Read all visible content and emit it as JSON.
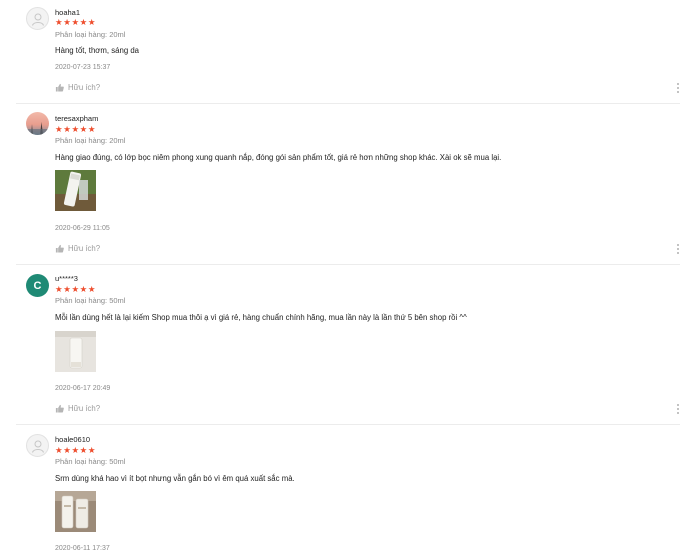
{
  "reviews": [
    {
      "username": "hoaha1",
      "stars": "★★★★★",
      "variant": "Phân loại hàng: 20ml",
      "comment": "Hàng tốt, thơm, sáng da",
      "date": "2020-07-23 15:37",
      "like_label": "Hữu ích?",
      "has_image": false
    },
    {
      "username": "teresaxpham",
      "stars": "★★★★★",
      "variant": "Phân loại hàng: 20ml",
      "comment": "Hàng giao đúng, có lớp bọc niêm phong xung quanh nắp, đóng gói sản phẩm tốt, giá rẻ hơn những shop khác. Xài ok sẽ mua lại.",
      "date": "2020-06-29 11:05",
      "like_label": "Hữu ích?",
      "has_image": true
    },
    {
      "username": "u*****3",
      "avatar_letter": "C",
      "stars": "★★★★★",
      "variant": "Phân loại hàng: 50ml",
      "comment": "Mỗi lần dùng hết là lại kiếm Shop mua thôi ạ vì giá rẻ, hàng chuẩn chính hãng,  mua lần này là lần thứ 5 bên shop rồi ^^",
      "date": "2020-06-17 20:49",
      "like_label": "Hữu ích?",
      "has_image": true
    },
    {
      "username": "hoale0610",
      "stars": "★★★★★",
      "variant": "Phân loại hàng: 50ml",
      "comment": "Srm dùng khá hao vì ít bọt nhưng vẫn gắn bó vì êm quá xuất sắc mà.",
      "date": "2020-06-11 17:37",
      "like_label": "",
      "has_image": true
    }
  ],
  "colors": {
    "star": "#ee4d2d",
    "avatar_letter_bg": "#1f8a75",
    "muted_text": "#8a8a8a"
  }
}
